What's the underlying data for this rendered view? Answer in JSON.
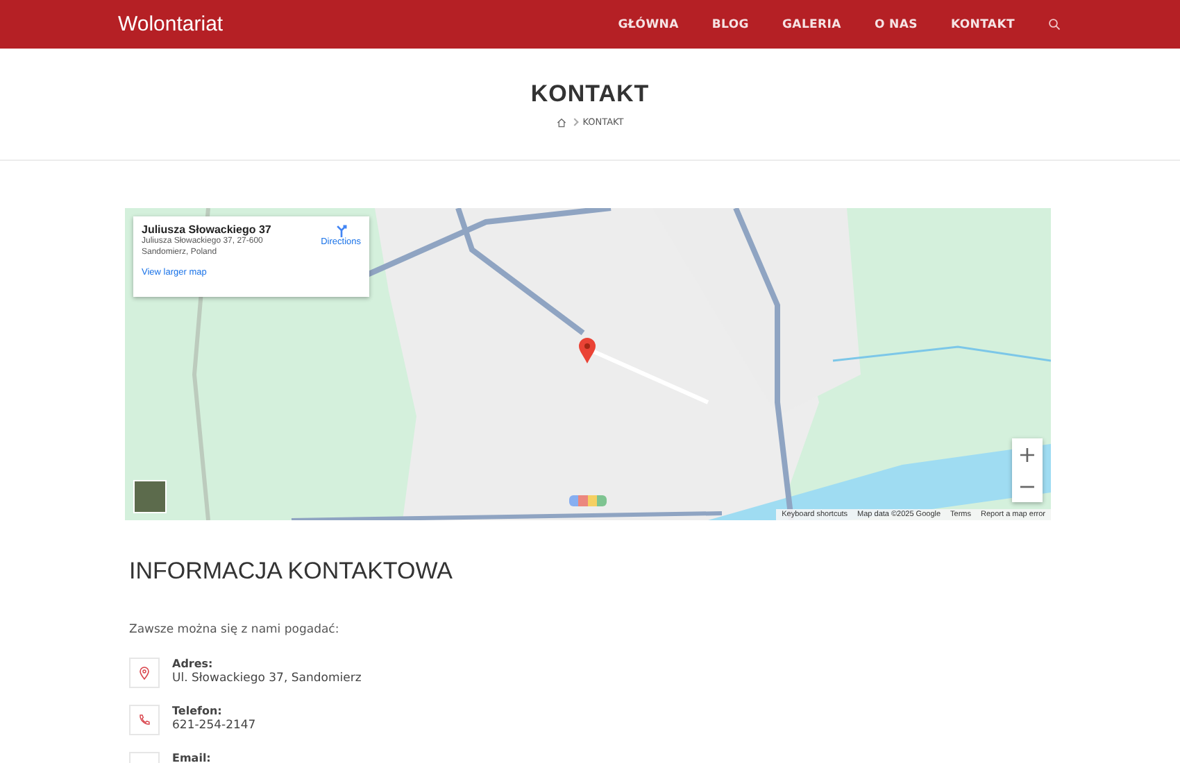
{
  "header": {
    "logo": "Wolontariat",
    "nav": [
      "GŁÓWNA",
      "BLOG",
      "GALERIA",
      "O NAS",
      "KONTAKT"
    ]
  },
  "page_title": {
    "title": "KONTAKT",
    "breadcrumb": "KONTAKT"
  },
  "map": {
    "card": {
      "title": "Juliusza Słowackiego 37",
      "address_line_1": "Juliusza Słowackiego 37, 27-600",
      "address_line_2": "Sandomierz, Poland",
      "directions": "Directions",
      "larger_map": "View larger map"
    },
    "zoom_in": "+",
    "zoom_out": "−",
    "footer": [
      "Keyboard shortcuts",
      "Map data ©2025 Google",
      "Terms",
      "Report a map error"
    ]
  },
  "contact": {
    "heading": "INFORMACJA KONTAKTOWA",
    "intro": "Zawsze można się z nami pogadać:",
    "items": [
      {
        "kind": "address",
        "label": "Adres:",
        "value": "Ul. Słowackiego 37, Sandomierz"
      },
      {
        "kind": "phone",
        "label": "Telefon:",
        "value": "621-254-2147"
      },
      {
        "kind": "email",
        "label": "Email:"
      }
    ]
  }
}
